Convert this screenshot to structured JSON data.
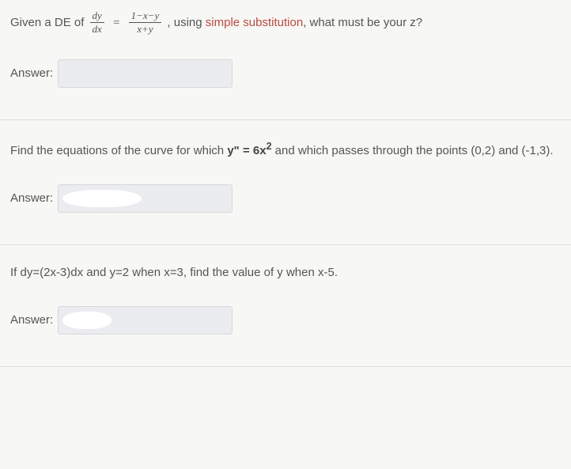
{
  "problems": [
    {
      "q_pre": "Given a DE of ",
      "frac1_num": "dy",
      "frac1_den": "dx",
      "eq_op": "=",
      "frac2_num": "1−x−y",
      "frac2_den": "x+y",
      "q_mid1": ", using ",
      "highlight": "simple substitution",
      "q_mid2": ", what must be your z?",
      "answer_label": "Answer:"
    },
    {
      "q_pre": "Find the equations of the curve for which ",
      "bold_pre": "y\" = 6x",
      "bold_sup": "2",
      "q_post": " and which passes through the points (0,2) and (-1,3).",
      "answer_label": "Answer:"
    },
    {
      "q_text": "If dy=(2x-3)dx and y=2 when x=3, find the value of y when x-5.",
      "answer_label": "Answer:"
    }
  ]
}
